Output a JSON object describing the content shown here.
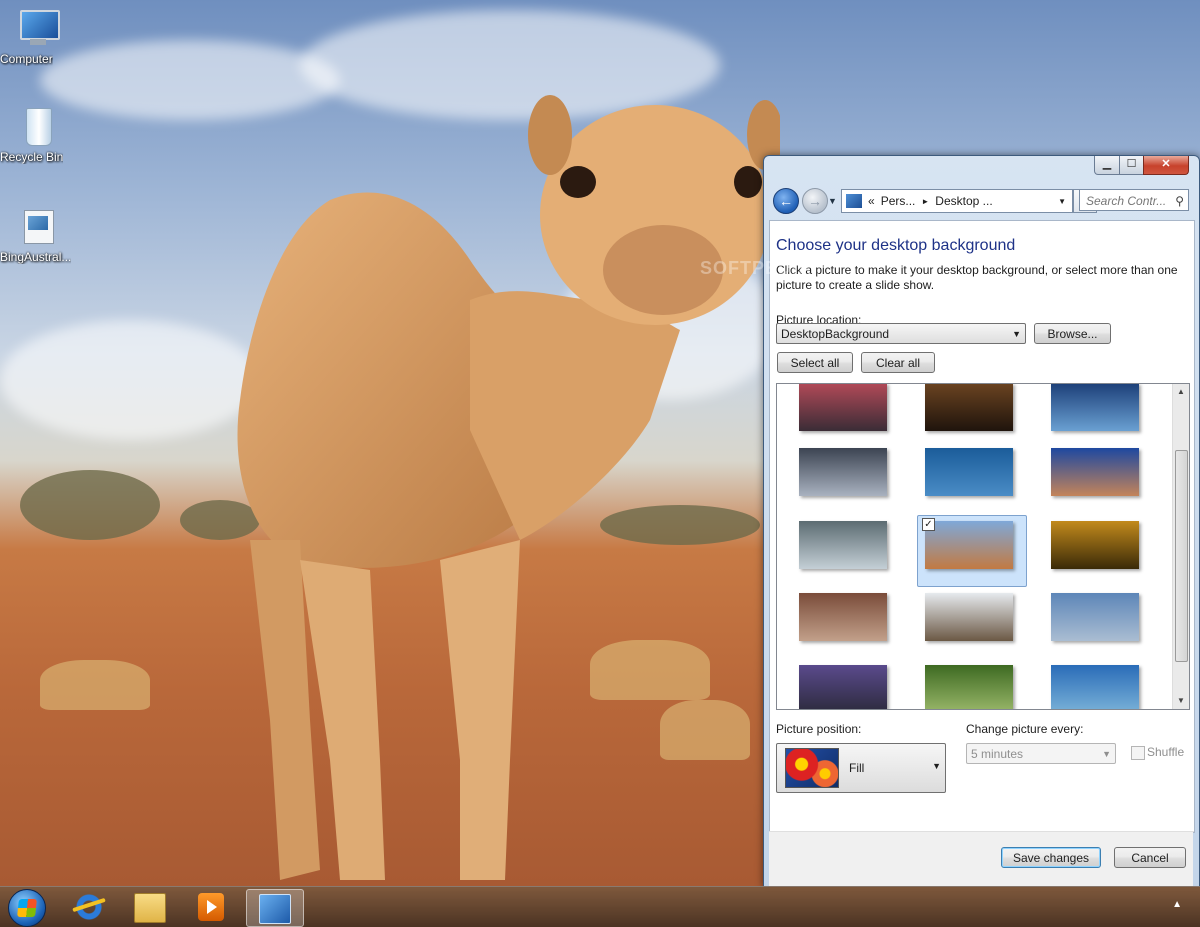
{
  "desktop": {
    "icons": [
      {
        "label": "Computer"
      },
      {
        "label": "Recycle Bin"
      },
      {
        "label": "BingAustral..."
      }
    ]
  },
  "window": {
    "caption_buttons": {
      "minimize": "▁",
      "maximize": "☐",
      "close": "✕"
    },
    "nav": {
      "back_glyph": "←",
      "forward_glyph": "→",
      "history_glyph": "▼",
      "address": {
        "prefix": "«",
        "crumb1": "Pers...",
        "sep": "►",
        "crumb2": "Desktop ...",
        "dropdown_glyph": "▼"
      },
      "refresh_glyph": "↻",
      "search_placeholder": "Search Contr...",
      "search_glyph": "⚲"
    },
    "heading": "Choose your desktop background",
    "description": "Click a picture to make it your desktop background, or select more than one picture to create a slide show.",
    "picture_location": {
      "label": "Picture location:",
      "value": "DesktopBackground",
      "browse_label": "Browse..."
    },
    "select_all_label": "Select all",
    "clear_all_label": "Clear all",
    "thumbnails": [
      {
        "name": "coastal-rocks",
        "colors": [
          "#b24a58",
          "#3a2c36"
        ]
      },
      {
        "name": "horse-eye",
        "colors": [
          "#6b4421",
          "#1f140c"
        ]
      },
      {
        "name": "mountain-lake",
        "colors": [
          "#1c3f78",
          "#6aa0d2"
        ]
      },
      {
        "name": "storm-lightning",
        "colors": [
          "#3c4452",
          "#a9b2c0"
        ]
      },
      {
        "name": "whale-tail",
        "colors": [
          "#1b5c9a",
          "#4a8cc6"
        ]
      },
      {
        "name": "rock-arch",
        "colors": [
          "#1e48a0",
          "#c4845a"
        ]
      },
      {
        "name": "cave-pool",
        "colors": [
          "#5c6c72",
          "#c4cfd6"
        ]
      },
      {
        "name": "camel",
        "colors": [
          "#7fa8d8",
          "#c27a42"
        ],
        "selected": true
      },
      {
        "name": "coral",
        "colors": [
          "#c28a1c",
          "#3a2a08"
        ]
      },
      {
        "name": "shells",
        "colors": [
          "#7a4c3a",
          "#c2a08a"
        ]
      },
      {
        "name": "snow-wombats",
        "colors": [
          "#e6eaee",
          "#6b5844"
        ]
      },
      {
        "name": "snow-gums",
        "colors": [
          "#5d86b8",
          "#aabdd2"
        ]
      },
      {
        "name": "jacaranda",
        "colors": [
          "#5a4a8c",
          "#2c2a3c"
        ]
      },
      {
        "name": "frog",
        "colors": [
          "#3e6a22",
          "#9ab86a"
        ]
      },
      {
        "name": "shipwreck",
        "colors": [
          "#2a6cb8",
          "#7ab2d8"
        ]
      }
    ],
    "picture_position": {
      "label": "Picture position:",
      "value": "Fill",
      "dropdown_glyph": "▼"
    },
    "change_picture": {
      "label": "Change picture every:",
      "value": "5 minutes",
      "dropdown_glyph": "▼"
    },
    "shuffle_label": "Shuffle",
    "save_label": "Save changes",
    "cancel_label": "Cancel"
  },
  "taskbar": {
    "items": [
      "start-button",
      "internet-explorer",
      "windows-explorer",
      "media-player",
      "control-panel"
    ],
    "tray_glyph": "▲"
  },
  "watermark": "SOFTPEDIA"
}
